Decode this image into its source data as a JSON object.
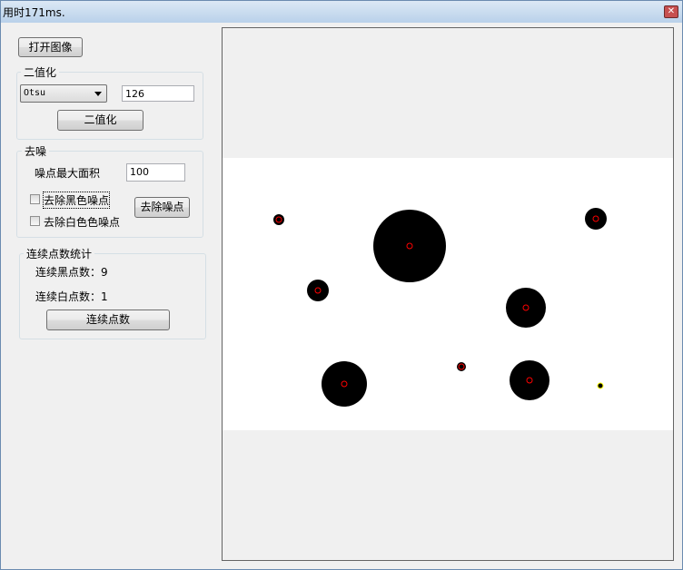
{
  "window": {
    "title": "用时171ms.",
    "close_icon": "close-icon"
  },
  "open_image_button": "打开图像",
  "binarize": {
    "group_label": "二值化",
    "method": "Otsu",
    "threshold": "126",
    "button": "二值化"
  },
  "denoise": {
    "group_label": "去噪",
    "max_area_label": "噪点最大面积",
    "max_area": "100",
    "remove_black_label": "去除黑色噪点",
    "remove_white_label": "去除白色色噪点",
    "remove_black_checked": false,
    "remove_white_checked": false,
    "button": "去除噪点"
  },
  "stats": {
    "group_label": "连续点数统计",
    "black_label": "连续黑点数：",
    "black_count": "9",
    "white_label": "连续白点数：",
    "white_count": "1",
    "button": "连续点数"
  },
  "colors": {
    "marker": "#ff0000",
    "white_marker": "#ffff00"
  }
}
